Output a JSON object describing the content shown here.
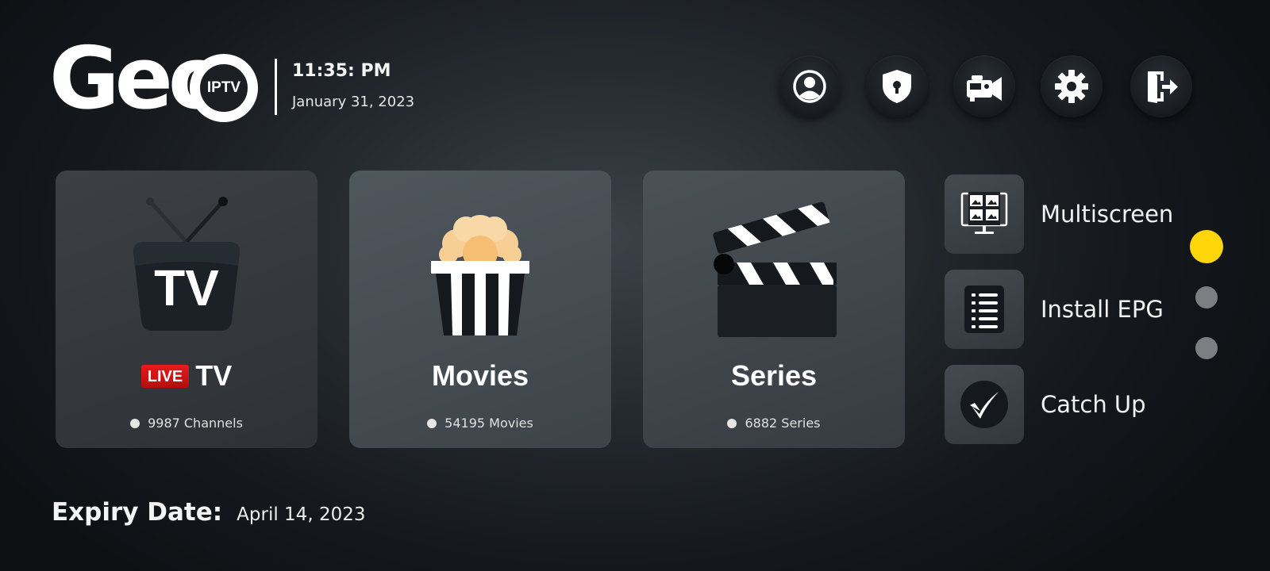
{
  "brand": {
    "logo_text": "Geo",
    "logo_badge": "IPTV"
  },
  "header": {
    "time": "11:35: PM",
    "date": "January  31, 2023"
  },
  "top_icons": [
    {
      "name": "profile-icon"
    },
    {
      "name": "parental-lock-icon"
    },
    {
      "name": "recording-icon"
    },
    {
      "name": "settings-icon"
    },
    {
      "name": "logout-icon"
    }
  ],
  "cards": {
    "live": {
      "badge": "LIVE",
      "title": "TV",
      "count": "9987 Channels"
    },
    "movies": {
      "title": "Movies",
      "count": "54195 Movies"
    },
    "series": {
      "title": "Series",
      "count": "6882 Series"
    }
  },
  "side_menu": {
    "items": [
      {
        "label": "Multiscreen"
      },
      {
        "label": "Install EPG"
      },
      {
        "label": "Catch Up"
      }
    ]
  },
  "pager": {
    "active_index": 0,
    "total": 3,
    "active_color": "#ffd60a",
    "inactive_color": "#7c7f82"
  },
  "footer": {
    "expiry_label": "Expiry Date:",
    "expiry_value": "April  14, 2023"
  },
  "colors": {
    "live_red": "#d61414",
    "accent_yellow": "#ffd60a"
  }
}
